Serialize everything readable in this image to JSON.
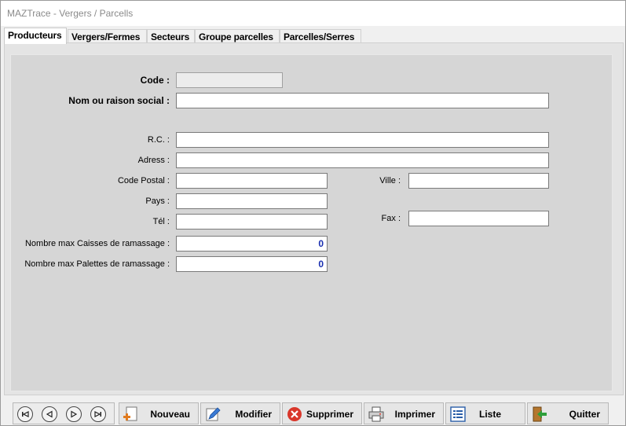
{
  "window": {
    "title": "MAZTrace - Vergers / Parcells"
  },
  "tabs": [
    {
      "label": "Producteurs"
    },
    {
      "label": "Vergers/Fermes"
    },
    {
      "label": "Secteurs"
    },
    {
      "label": "Groupe parcelles"
    },
    {
      "label": "Parcelles/Serres"
    }
  ],
  "form": {
    "code_label": "Code :",
    "code_value": "",
    "name_label": "Nom ou raison social  :",
    "name_value": "",
    "rc_label": "R.C. :",
    "rc_value": "",
    "address_label": "Adress :",
    "address_value": "",
    "postal_label": "Code Postal :",
    "postal_value": "",
    "ville_label": "Ville :",
    "ville_value": "",
    "pays_label": "Pays :",
    "pays_value": "",
    "tel_label": "Tél :",
    "tel_value": "",
    "fax_label": "Fax :",
    "fax_value": "",
    "caisses_label": "Nombre max Caisses de ramassage :",
    "caisses_value": "0",
    "palettes_label": "Nombre max Palettes de ramassage :",
    "palettes_value": "0"
  },
  "toolbar": {
    "nav_icons": [
      "first-record-icon",
      "previous-record-icon",
      "next-record-icon",
      "last-record-icon"
    ],
    "buttons": [
      {
        "label": "Nouveau",
        "icon": "new-document-icon"
      },
      {
        "label": "Modifier",
        "icon": "pencil-icon"
      },
      {
        "label": "Supprimer",
        "icon": "delete-icon"
      },
      {
        "label": "Imprimer",
        "icon": "printer-icon"
      },
      {
        "label": "Liste",
        "icon": "list-icon"
      },
      {
        "label": "Quitter",
        "icon": "exit-door-icon"
      }
    ]
  },
  "colors": {
    "panel_bg": "#d6d6d6",
    "numeric_text": "#1a2fb0",
    "delete_red": "#d9372b",
    "new_accent": "#e07b20",
    "exit_green": "#2e9e3a"
  }
}
